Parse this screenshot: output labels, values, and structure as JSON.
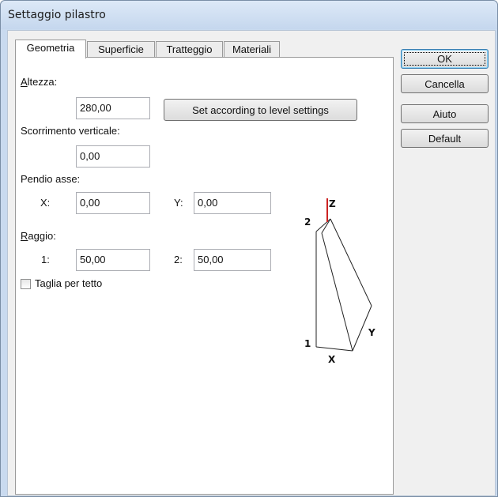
{
  "window": {
    "title": "Settaggio pilastro"
  },
  "tabs": [
    {
      "label": "Geometria",
      "active": true
    },
    {
      "label": "Superficie",
      "active": false
    },
    {
      "label": "Tratteggio",
      "active": false
    },
    {
      "label": "Materiali",
      "active": false
    }
  ],
  "geometria": {
    "altezza_label": "Altezza:",
    "altezza_value": "280,00",
    "set_level_button": "Set according to level settings",
    "scorrimento_label": "Scorrimento verticale:",
    "scorrimento_value": "0,00",
    "pendio_label": "Pendio asse:",
    "pendio_x_label": "X:",
    "pendio_x_value": "0,00",
    "pendio_y_label": "Y:",
    "pendio_y_value": "0,00",
    "raggio_label": "Raggio:",
    "raggio_1_label": "1:",
    "raggio_1_value": "50,00",
    "raggio_2_label": "2:",
    "raggio_2_value": "50,00",
    "taglia_label": "Taglia per tetto",
    "taglia_checked": false
  },
  "diagram": {
    "label_z": "Z",
    "label_2": "2",
    "label_1": "1",
    "label_x": "X",
    "label_y": "Y",
    "axis_color": "#cc2222"
  },
  "buttons": {
    "ok": "OK",
    "cancel": "Cancella",
    "help": "Aiuto",
    "default": "Default"
  }
}
